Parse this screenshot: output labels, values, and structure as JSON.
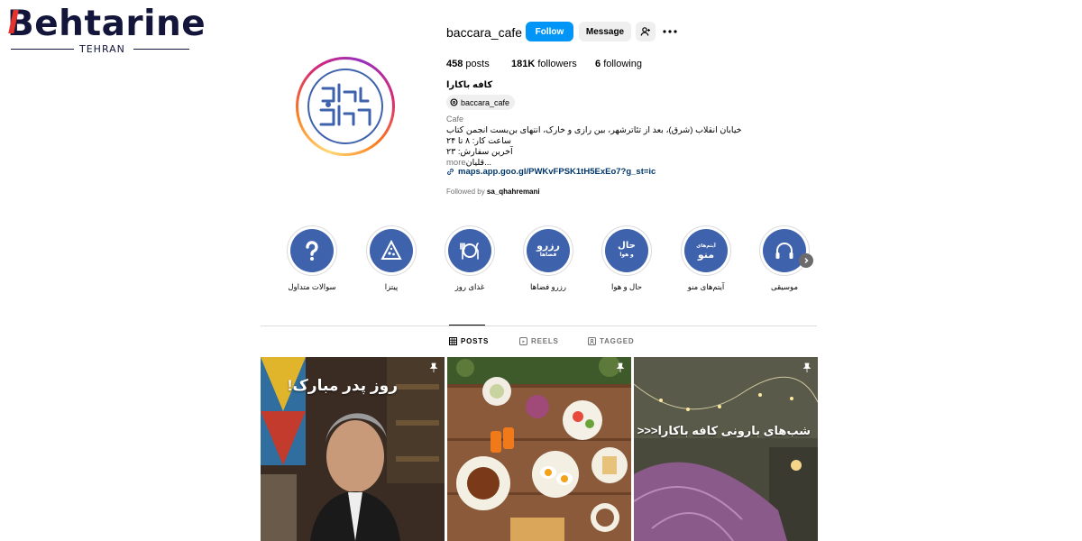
{
  "watermark": {
    "word": "ehtarine",
    "first_letter": "B",
    "subtitle": "TEHRAN"
  },
  "profile": {
    "username": "baccara_cafe",
    "follow_label": "Follow",
    "message_label": "Message",
    "avatar_text_top": "کافه",
    "avatar_text_bottom": "باکارا",
    "stats": {
      "posts_count": "458",
      "posts_label": "posts",
      "followers_count": "181K",
      "followers_label": "followers",
      "following_count": "6",
      "following_label": "following"
    },
    "display_name": "کافه باکارا",
    "threads_handle": "baccara_cafe",
    "category": "Cafe",
    "bio_lines": [
      "خیابان انقلاب (شرق)، بعد از تئاترشهر، بین رازی و خارک، انتهای بن‌بست انجمن کتاب",
      "ساعت کار: ۸ تا ۲۴",
      "آخرین سفارش: ۲۳"
    ],
    "bio_truncated": "قلیان...",
    "more_label": "more",
    "link": "maps.app.goo.gl/PWKvFPSK1tH5ExEo7?g_st=ic",
    "followed_by_prefix": "Followed by",
    "followed_by_user": "sa_qhahremani"
  },
  "highlights": [
    {
      "label": "سوالات متداول",
      "icon": "question-icon",
      "circle_text": ""
    },
    {
      "label": "پیتزا",
      "icon": "pizza-icon",
      "circle_text": ""
    },
    {
      "label": "غذای روز",
      "icon": "plate-cutlery-icon",
      "circle_text": ""
    },
    {
      "label": "رزرو فضاها",
      "icon": "reserve-icon",
      "circle_text": "رزرو",
      "circle_sub": "فضاها"
    },
    {
      "label": "حال و هوا",
      "icon": "mood-icon",
      "circle_text": "حال",
      "circle_sub": "و هوا"
    },
    {
      "label": "آیتم‌های منو",
      "icon": "menu-icon",
      "circle_text": "منو",
      "circle_sub": "آیتم‌های"
    },
    {
      "label": "موسیقی",
      "icon": "headphones-icon",
      "circle_text": ""
    }
  ],
  "tabs": [
    {
      "label": "POSTS",
      "icon": "grid-icon",
      "active": true
    },
    {
      "label": "REELS",
      "icon": "reels-icon",
      "active": false
    },
    {
      "label": "TAGGED",
      "icon": "tagged-icon",
      "active": false
    }
  ],
  "posts": [
    {
      "caption": "روز پدر مبارک!",
      "pinned": true
    },
    {
      "caption": "",
      "pinned": true
    },
    {
      "caption": "شب‌های بارونی کافه باکارا<<<",
      "pinned": true
    }
  ],
  "colors": {
    "brand_blue": "#3f62ad",
    "follow_blue": "#0095f6",
    "link_blue": "#00376b"
  }
}
